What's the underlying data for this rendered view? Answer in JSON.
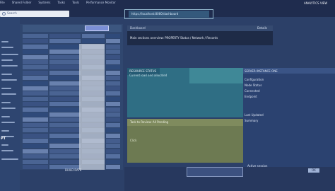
{
  "top_menu": [
    "File",
    "Shared Folder",
    "Systems",
    "Tasks",
    "Tools",
    "Performance Monitor"
  ],
  "search": {
    "placeholder": "Search"
  },
  "address_bar": {
    "text": "https://localhost:8080/dashboard"
  },
  "right_title": "ANALYTICS VIEW",
  "rail_logo": "PT",
  "center_panel": {
    "label": "Dashboard",
    "text": "Main sections overview: PROPERTY   Status / Network / Records",
    "right_label": "Details"
  },
  "teal_panel": {
    "title": "RESOURCE STATUS",
    "subtitle": "Current load and allocated"
  },
  "olive_panel": {
    "title": "Task to Review: All Pending",
    "hint": "Click"
  },
  "right_panel": {
    "items": [
      "SERVER INSTANCE ONE",
      "Configuration",
      "Node Status",
      "Connected",
      "Endpoint",
      "Last Updated",
      "Summary"
    ]
  },
  "bottom": {
    "labels": "BUILD  RATE",
    "chip_text": "Active session",
    "btn": "OK"
  },
  "colors": {
    "accent_teal": "#2f6e84",
    "accent_olive": "#6d7a52",
    "accent_blue": "#7b8fd6"
  }
}
